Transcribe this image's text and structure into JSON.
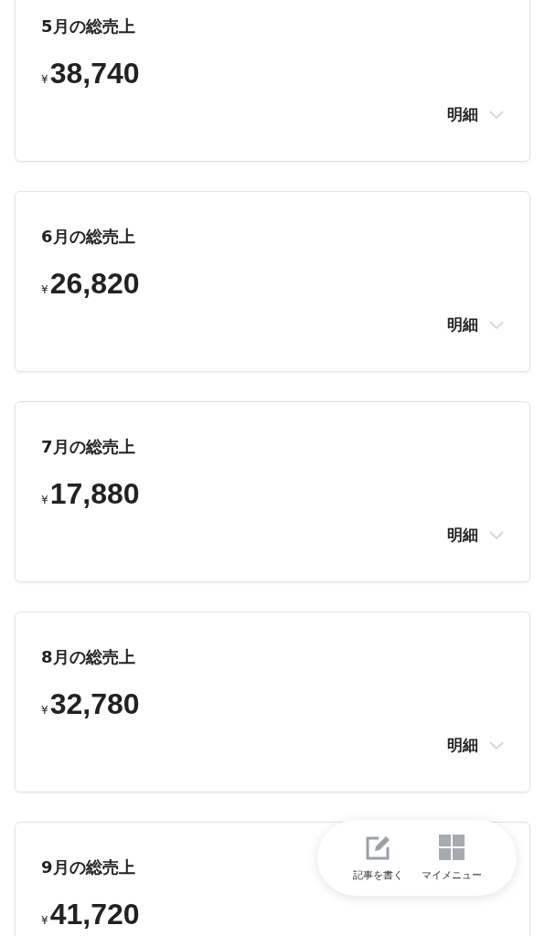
{
  "cards": [
    {
      "title": "5月の総売上",
      "currency": "¥",
      "amount": "38,740",
      "detail_label": "明細"
    },
    {
      "title": "6月の総売上",
      "currency": "¥",
      "amount": "26,820",
      "detail_label": "明細"
    },
    {
      "title": "7月の総売上",
      "currency": "¥",
      "amount": "17,880",
      "detail_label": "明細"
    },
    {
      "title": "8月の総売上",
      "currency": "¥",
      "amount": "32,780",
      "detail_label": "明細"
    },
    {
      "title": "9月の総売上",
      "currency": "¥",
      "amount": "41,720"
    }
  ],
  "floating_menu": [
    {
      "kind": "write",
      "label": "記事を書く"
    },
    {
      "kind": "grid",
      "label": "マイメニュー"
    }
  ]
}
